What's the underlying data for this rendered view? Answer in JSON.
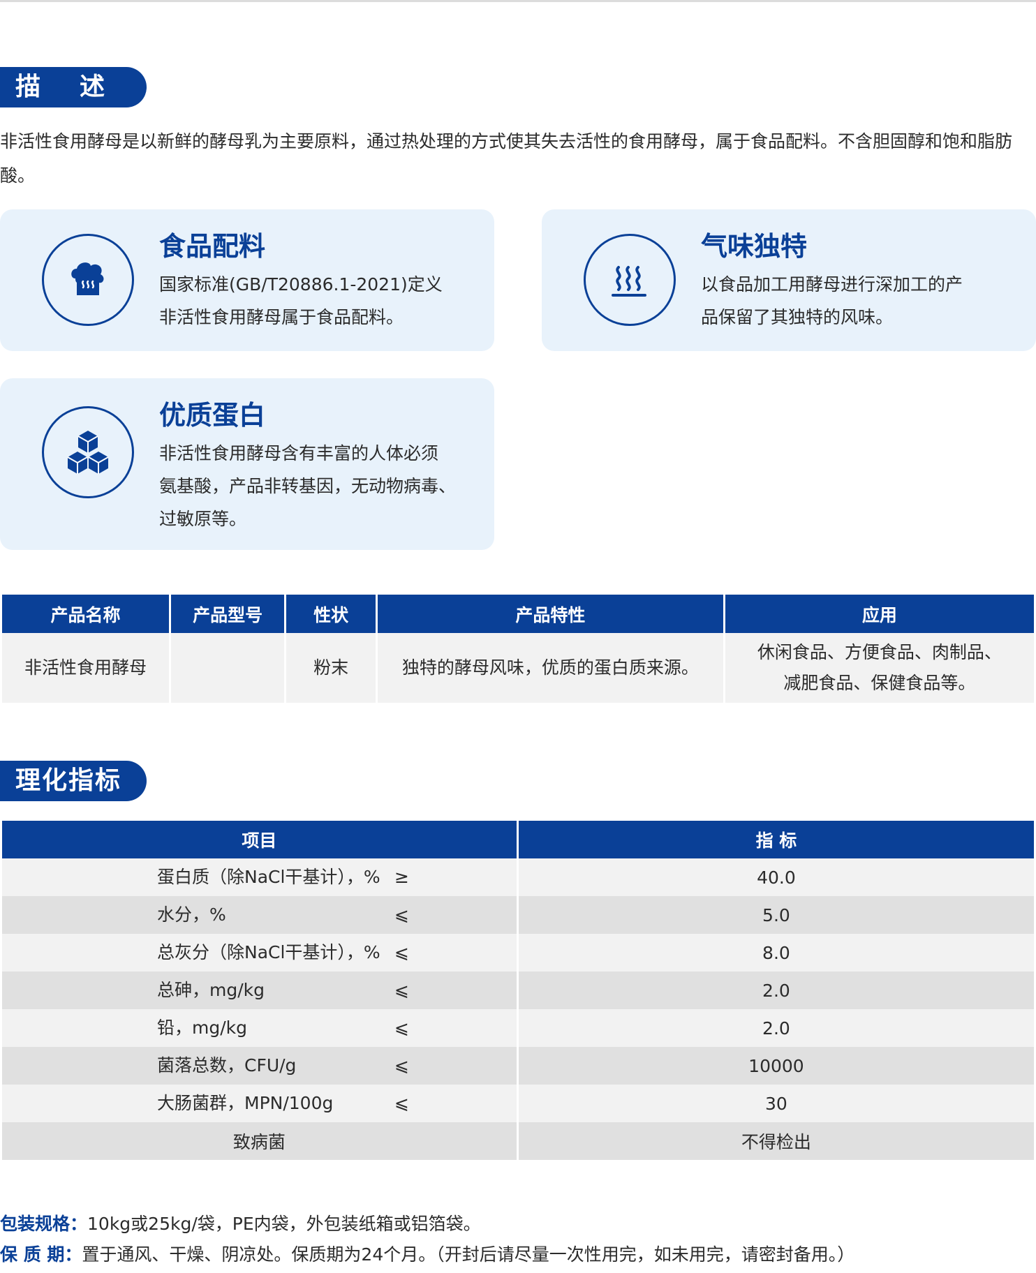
{
  "sections": {
    "description_title": "描述",
    "physchem_title": "理化指标"
  },
  "description": {
    "text": "非活性食用酵母是以新鲜的酵母乳为主要原料，通过热处理的方式使其失去活性的食用酵母，属于食品配料。不含胆固醇和饱和脂肪酸。"
  },
  "features": [
    {
      "icon": "chef-hat-icon",
      "title": "食品配料",
      "text_line1": "国家标准(GB/T20886.1-2021)定义",
      "text_line2": "非活性食用酵母属于食品配料。"
    },
    {
      "icon": "steam-aroma-icon",
      "title": "气味独特",
      "text_line1": "以食品加工用酵母进行深加工的产",
      "text_line2": "品保留了其独特的风味。"
    },
    {
      "icon": "cubes-icon",
      "title": "优质蛋白",
      "text_line1": "非活性食用酵母含有丰富的人体必须",
      "text_line2": "氨基酸，产品非转基因，无动物病毒、",
      "text_line3": "过敏原等。"
    }
  ],
  "product_table": {
    "headers": [
      "产品名称",
      "产品型号",
      "性状",
      "产品特性",
      "应用"
    ],
    "row": {
      "name": "非活性食用酵母",
      "model": "",
      "form": "粉末",
      "feature": "独特的酵母风味，优质的蛋白质来源。",
      "app_line1": "休闲食品、方便食品、肉制品、",
      "app_line2": "减肥食品、保健食品等。"
    }
  },
  "physchem_table": {
    "headers": [
      "项目",
      "指 标"
    ],
    "rows": [
      {
        "item": "蛋白质（除NaCl干基计），%",
        "op": "≥",
        "value": "40.0"
      },
      {
        "item": "水分，%",
        "op": "⩽",
        "value": "5.0"
      },
      {
        "item": "总灰分（除NaCl干基计），%",
        "op": "⩽",
        "value": "8.0"
      },
      {
        "item": "总砷，mg/kg",
        "op": "⩽",
        "value": "2.0"
      },
      {
        "item": "铅，mg/kg",
        "op": "⩽",
        "value": "2.0"
      },
      {
        "item": "菌落总数，CFU/g",
        "op": "⩽",
        "value": "10000"
      },
      {
        "item": "大肠菌群，MPN/100g",
        "op": "⩽",
        "value": "30"
      },
      {
        "item": "致病菌",
        "op": "",
        "value": "不得检出"
      }
    ]
  },
  "footer": {
    "packaging_label": "包装规格：",
    "packaging_text": "10kg或25kg/袋，PE内袋，外包装纸箱或铝箔袋。",
    "shelf_label": "保 质 期：",
    "shelf_text": "置于通风、干燥、阴凉处。保质期为24个月。（开封后请尽量一次性用完，如未用完，请密封备用。）"
  },
  "colors": {
    "brand_blue": "#0a4097",
    "card_bg": "#e8f2fb",
    "row_light": "#f2f2f2",
    "row_dark": "#e0e0e0"
  }
}
